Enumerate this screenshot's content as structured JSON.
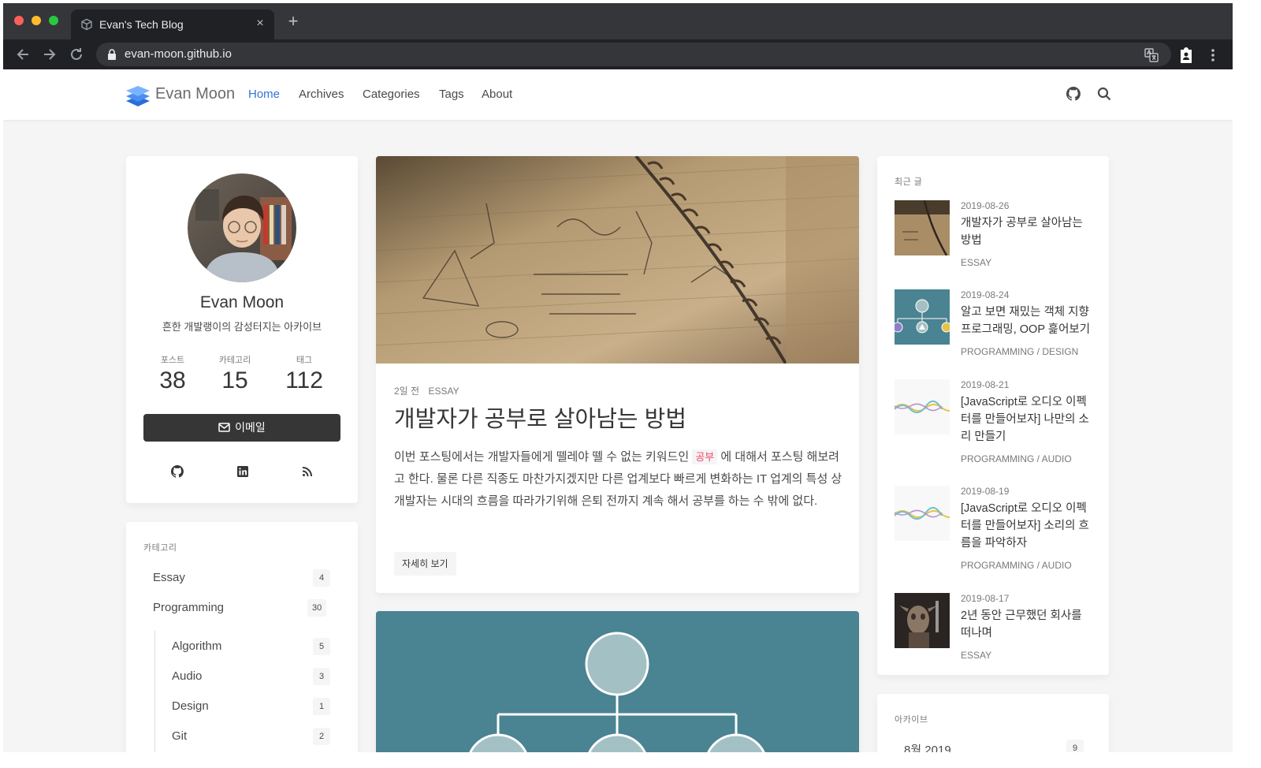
{
  "browser": {
    "tab_title": "Evan's Tech Blog",
    "tab_close": "×",
    "new_tab": "+",
    "url": "evan-moon.github.io"
  },
  "navbar": {
    "brand": "Evan Moon",
    "links": [
      "Home",
      "Archives",
      "Categories",
      "Tags",
      "About"
    ],
    "active": "Home"
  },
  "profile": {
    "name": "Evan Moon",
    "bio": "흔한 개발랭이의 감성터지는 아카이브",
    "stats": [
      {
        "label": "포스트",
        "value": "38"
      },
      {
        "label": "카테고리",
        "value": "15"
      },
      {
        "label": "태그",
        "value": "112"
      }
    ],
    "email_label": "이메일",
    "social_icons": [
      "github-icon",
      "linkedin-icon",
      "rss-icon"
    ]
  },
  "categories": {
    "label": "카테고리",
    "items": [
      {
        "name": "Essay",
        "count": "4"
      },
      {
        "name": "Programming",
        "count": "30"
      }
    ],
    "sub_items": [
      {
        "name": "Algorithm",
        "count": "5"
      },
      {
        "name": "Audio",
        "count": "3"
      },
      {
        "name": "Design",
        "count": "1"
      },
      {
        "name": "Git",
        "count": "2"
      }
    ]
  },
  "post": {
    "meta_time": "2일 전",
    "meta_category": "ESSAY",
    "title": "개발자가 공부로 살아남는 방법",
    "body_before": "이번 포스팅에서는 개발자들에게 뗄레야 뗄 수 없는 키워드인 ",
    "body_tag": "공부",
    "body_after": " 에 대해서 포스팅 해보려고 한다. 물론 다른 직종도 마찬가지겠지만 다른 업계보다 빠르게 변화하는 IT 업계의 특성 상 개발자는 시대의 흐름을 따라가기위해 은퇴 전까지 계속 해서 공부를 하는 수 밖에 없다.",
    "more_label": "자세히 보기"
  },
  "recent": {
    "label": "최근 글",
    "items": [
      {
        "date": "2019-08-26",
        "title": "개발자가 공부로 살아남는 방법",
        "category": "ESSAY"
      },
      {
        "date": "2019-08-24",
        "title": "알고 보면 재밌는 객체 지향 프로그래밍, OOP 흝어보기",
        "category": "PROGRAMMING / DESIGN"
      },
      {
        "date": "2019-08-21",
        "title": "[JavaScript로 오디오 이펙터를 만들어보자] 나만의 소리 만들기",
        "category": "PROGRAMMING / AUDIO"
      },
      {
        "date": "2019-08-19",
        "title": "[JavaScript로 오디오 이펙터를 만들어보자] 소리의 흐름을 파악하자",
        "category": "PROGRAMMING / AUDIO"
      },
      {
        "date": "2019-08-17",
        "title": "2년 동안 근무했던 회사를 떠나며",
        "category": "ESSAY"
      }
    ]
  },
  "archive": {
    "label": "아카이브",
    "items": [
      {
        "month": "8월 2019",
        "count": "9"
      }
    ]
  },
  "colors": {
    "accent": "#3273dc",
    "dark_button": "#363636",
    "tag_red": "#f14668",
    "oop_teal": "#4a8391"
  }
}
